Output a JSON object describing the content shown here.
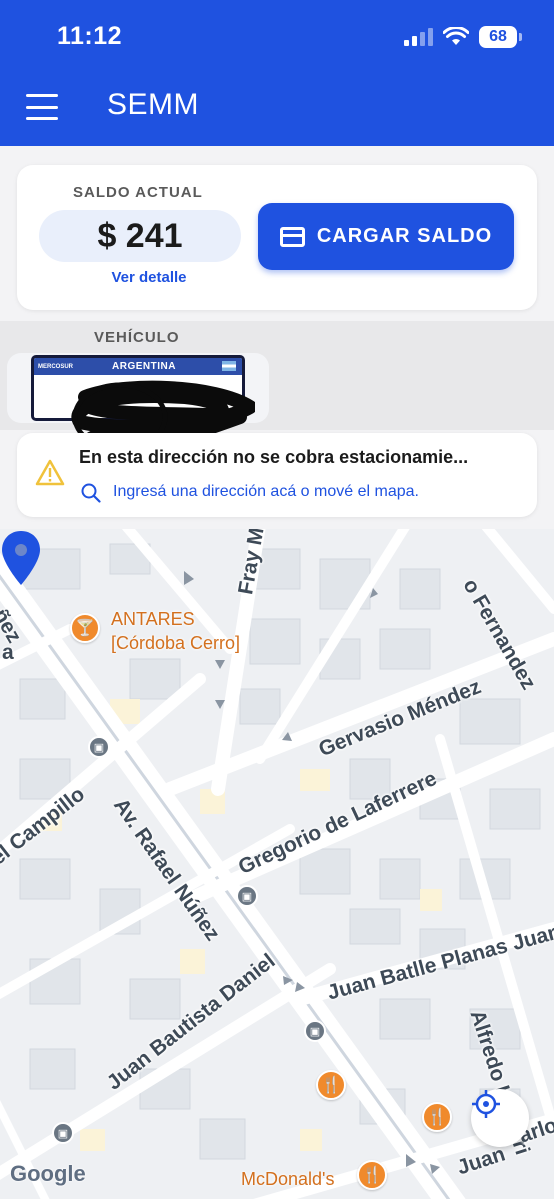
{
  "status_bar": {
    "time": "11:12",
    "battery": "68"
  },
  "app": {
    "title": "SEMM"
  },
  "balance": {
    "label": "SALDO ACTUAL",
    "amount": "$ 241",
    "detail_link": "Ver detalle",
    "load_button": "CARGAR SALDO"
  },
  "vehicle": {
    "label": "VEHÍCULO",
    "plate_country": "ARGENTINA",
    "plate_prefix": "MERCOSUR"
  },
  "address": {
    "title": "En esta dirección no se cobra estacionamie...",
    "hint": "Ingresá una dirección acá o mové el mapa."
  },
  "map": {
    "streets": [
      "Fray M",
      "o Fernandez",
      "ñez",
      "a",
      "Gervasio Méndez",
      "el Campillo",
      "Av. Rafael Núñez",
      "Gregorio de Laferrere",
      "Juan Batlle Planas Juan B",
      "Alfredo Lazzari",
      "Juan Bautista Daniel",
      "Juan",
      "arlo"
    ],
    "pois": [
      {
        "name_line1": "ANTARES",
        "name_line2": "[Córdoba Cerro]",
        "icon": "cocktail-icon"
      },
      {
        "name_line1": "McDonald's",
        "icon": "restaurant-icon"
      }
    ],
    "attribution": "Google",
    "colors": {
      "pin": "#1f52e0",
      "poi": "#f08a2c",
      "header": "#1f52e0"
    }
  }
}
